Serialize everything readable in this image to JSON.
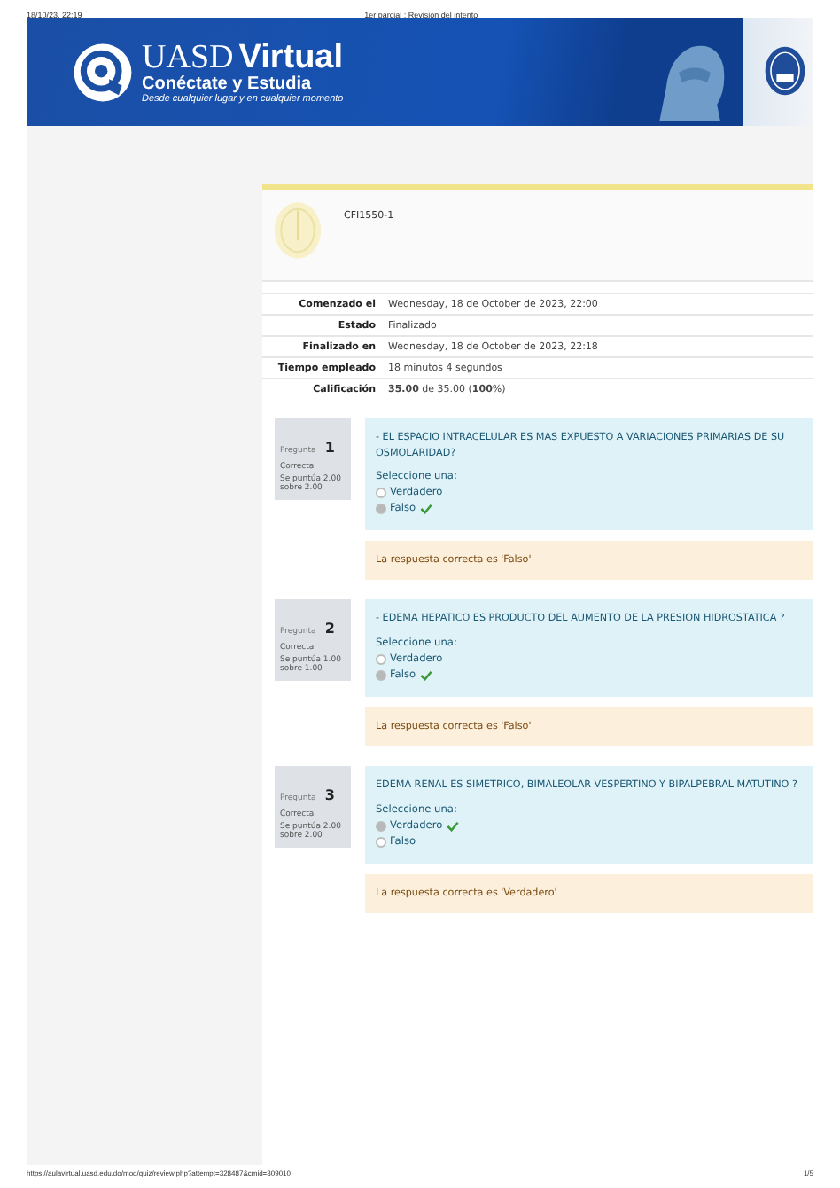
{
  "print_header": {
    "date": "18/10/23, 22:19",
    "title": "1er parcial : Revisión del intento"
  },
  "banner": {
    "brand_1": "UASD",
    "brand_2": "Virtual",
    "slogan": "Conéctate y Estudia",
    "tagline": "Desde cualquier lugar y en cualquier momento"
  },
  "course": {
    "code": "CFI1550-1"
  },
  "summary": [
    {
      "label": "Comenzado el",
      "value": "Wednesday, 18 de October de 2023, 22:00"
    },
    {
      "label": "Estado",
      "value": "Finalizado"
    },
    {
      "label": "Finalizado en",
      "value": "Wednesday, 18 de October de 2023, 22:18"
    },
    {
      "label": "Tiempo empleado",
      "value": "18 minutos 4 segundos"
    },
    {
      "label": "Calificación",
      "value": "**35.00** de 35.00 (**100**%)"
    }
  ],
  "questions": [
    {
      "label": "Pregunta",
      "number": "1",
      "state": "Correcta",
      "mark": "Se puntúa 2.00 sobre 2.00",
      "text": "- EL ESPACIO INTRACELULAR ES MAS EXPUESTO A VARIACIONES PRIMARIAS DE SU OSMOLARIDAD?",
      "prompt": "Seleccione una:",
      "options": [
        {
          "label": "Verdadero",
          "selected": false,
          "correct": false
        },
        {
          "label": "Falso",
          "selected": true,
          "correct": true
        }
      ],
      "feedback": "La respuesta correcta es 'Falso'"
    },
    {
      "label": "Pregunta",
      "number": "2",
      "state": "Correcta",
      "mark": "Se puntúa 1.00 sobre 1.00",
      "text": "- EDEMA HEPATICO ES PRODUCTO DEL AUMENTO DE LA PRESION HIDROSTATICA ?",
      "prompt": "Seleccione una:",
      "options": [
        {
          "label": "Verdadero",
          "selected": false,
          "correct": false
        },
        {
          "label": "Falso",
          "selected": true,
          "correct": true
        }
      ],
      "feedback": "La respuesta correcta es 'Falso'"
    },
    {
      "label": "Pregunta",
      "number": "3",
      "state": "Correcta",
      "mark": "Se puntúa 2.00 sobre 2.00",
      "text": "EDEMA RENAL ES SIMETRICO, BIMALEOLAR VESPERTINO Y BIPALPEBRAL MATUTINO ?",
      "prompt": "Seleccione una:",
      "options": [
        {
          "label": "Verdadero",
          "selected": true,
          "correct": true
        },
        {
          "label": "Falso",
          "selected": false,
          "correct": false
        }
      ],
      "feedback": "La respuesta correcta es 'Verdadero'"
    }
  ],
  "print_footer": {
    "url": "https://aulavirtual.uasd.edu.do/mod/quiz/review.php?attempt=328487&cmid=309010",
    "page": "1/5"
  }
}
